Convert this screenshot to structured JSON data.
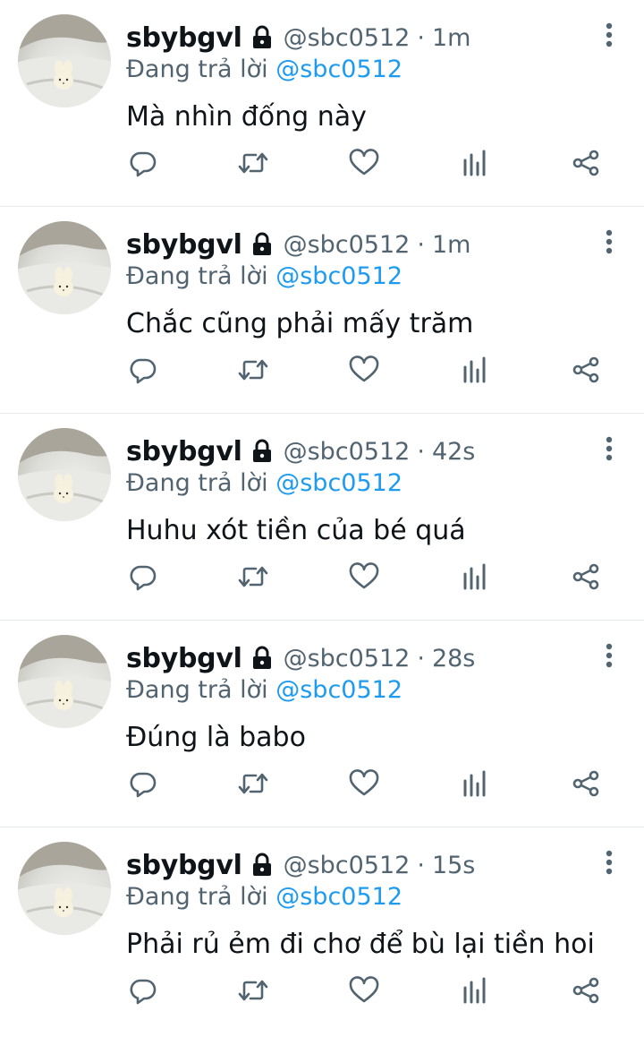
{
  "colors": {
    "text_primary": "#0f1419",
    "text_secondary": "#536471",
    "link": "#1d9bf0",
    "divider": "#e6e9eb"
  },
  "icons": {
    "lock": "lock-icon",
    "more": "more-vertical-icon",
    "reply": "reply-icon",
    "retweet": "retweet-icon",
    "like": "heart-icon",
    "views": "views-chart-icon",
    "share": "share-icon"
  },
  "tweets": [
    {
      "name": "sbybgvl",
      "handle": "@sbc0512",
      "separator": "·",
      "time": "1m",
      "reply_prefix": "Đang trả lời",
      "reply_to": "@sbc0512",
      "text": "Mà nhìn đống này"
    },
    {
      "name": "sbybgvl",
      "handle": "@sbc0512",
      "separator": "·",
      "time": "1m",
      "reply_prefix": "Đang trả lời",
      "reply_to": "@sbc0512",
      "text": "Chắc cũng phải mấy trăm"
    },
    {
      "name": "sbybgvl",
      "handle": "@sbc0512",
      "separator": "·",
      "time": "42s",
      "reply_prefix": "Đang trả lời",
      "reply_to": "@sbc0512",
      "text": "Huhu xót tiền của bé quá"
    },
    {
      "name": "sbybgvl",
      "handle": "@sbc0512",
      "separator": "·",
      "time": "28s",
      "reply_prefix": "Đang trả lời",
      "reply_to": "@sbc0512",
      "text": "Đúng là babo"
    },
    {
      "name": "sbybgvl",
      "handle": "@sbc0512",
      "separator": "·",
      "time": "15s",
      "reply_prefix": "Đang trả lời",
      "reply_to": "@sbc0512",
      "text": "Phải rủ ẻm đi chơ để bù lại tiền hoi"
    }
  ]
}
